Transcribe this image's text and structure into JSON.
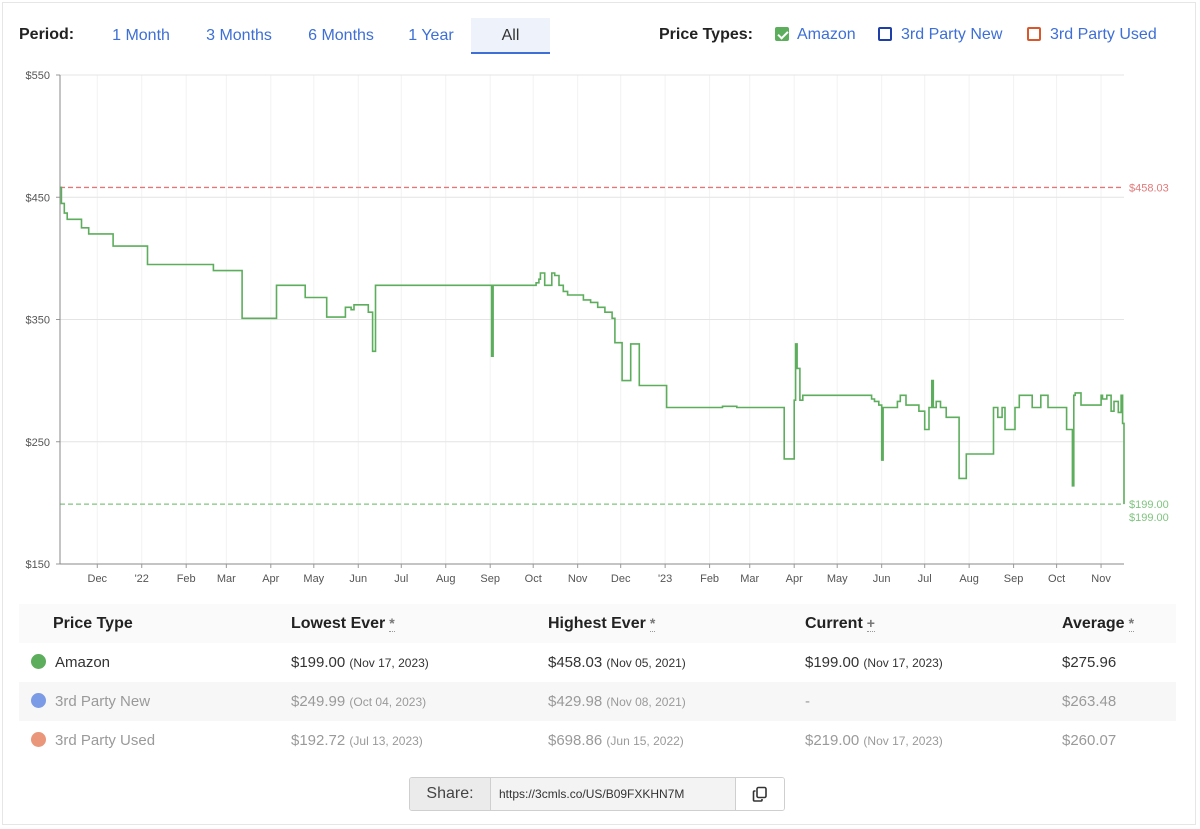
{
  "period": {
    "label": "Period:",
    "options": [
      "1 Month",
      "3 Months",
      "6 Months",
      "1 Year",
      "All"
    ],
    "selected": "All"
  },
  "price_types": {
    "label": "Price Types:",
    "items": [
      {
        "label": "Amazon",
        "checked": true,
        "color": "#5cad5c"
      },
      {
        "label": "3rd Party New",
        "checked": false,
        "color": "#1f3fa8"
      },
      {
        "label": "3rd Party Used",
        "checked": false,
        "color": "#d9582b"
      }
    ]
  },
  "chart_data": {
    "type": "line",
    "step": true,
    "y_ticks": [
      "$550",
      "$450",
      "$350",
      "$250",
      "$150"
    ],
    "ylim": [
      150,
      550
    ],
    "x_ticks": [
      "Dec",
      "'22",
      "Feb",
      "Mar",
      "Apr",
      "May",
      "Jun",
      "Jul",
      "Aug",
      "Sep",
      "Oct",
      "Nov",
      "Dec",
      "'23",
      "Feb",
      "Mar",
      "Apr",
      "May",
      "Jun",
      "Jul",
      "Aug",
      "Sep",
      "Oct",
      "Nov"
    ],
    "reference_lines": [
      {
        "label": "$458.03",
        "value": 458.03,
        "color": "#e07a7a"
      },
      {
        "label": "$199.00",
        "value": 199.0,
        "color": "#7fc47f"
      }
    ],
    "end_label": "$199.00",
    "grid": true,
    "series": [
      {
        "name": "Amazon",
        "color": "#5cad5c",
        "x": [
          "2021-11-05",
          "2021-11-06",
          "2021-11-08",
          "2021-11-10",
          "2021-11-12",
          "2021-11-20",
          "2021-11-25",
          "2021-12-05",
          "2021-12-12",
          "2022-01-05",
          "2022-02-20",
          "2022-03-12",
          "2022-04-05",
          "2022-04-25",
          "2022-04-28",
          "2022-05-10",
          "2022-05-20",
          "2022-05-23",
          "2022-05-27",
          "2022-05-29",
          "2022-06-01",
          "2022-06-08",
          "2022-06-11",
          "2022-06-13",
          "2022-06-17",
          "2022-08-15",
          "2022-09-02",
          "2022-09-03",
          "2022-09-09",
          "2022-09-30",
          "2022-10-03",
          "2022-10-05",
          "2022-10-06",
          "2022-10-09",
          "2022-10-14",
          "2022-10-16",
          "2022-10-19",
          "2022-10-22",
          "2022-10-25",
          "2022-11-05",
          "2022-11-10",
          "2022-11-15",
          "2022-11-20",
          "2022-11-25",
          "2022-11-27",
          "2022-12-02",
          "2022-12-08",
          "2022-12-14",
          "2023-01-02",
          "2023-01-20",
          "2023-02-01",
          "2023-02-10",
          "2023-02-20",
          "2023-03-01",
          "2023-03-10",
          "2023-03-23",
          "2023-03-25",
          "2023-04-01",
          "2023-04-02",
          "2023-04-03",
          "2023-04-05",
          "2023-04-07",
          "2023-04-15",
          "2023-05-05",
          "2023-05-15",
          "2023-05-25",
          "2023-05-27",
          "2023-05-30",
          "2023-06-01",
          "2023-06-02",
          "2023-06-10",
          "2023-06-12",
          "2023-06-14",
          "2023-06-18",
          "2023-06-20",
          "2023-06-27",
          "2023-07-01",
          "2023-07-03",
          "2023-07-04",
          "2023-07-06",
          "2023-07-07",
          "2023-07-09",
          "2023-07-12",
          "2023-07-13",
          "2023-07-16",
          "2023-07-25",
          "2023-07-30",
          "2023-08-18",
          "2023-08-21",
          "2023-08-24",
          "2023-08-26",
          "2023-09-01",
          "2023-09-02",
          "2023-09-05",
          "2023-09-14",
          "2023-09-20",
          "2023-09-25",
          "2023-10-08",
          "2023-10-10",
          "2023-10-11",
          "2023-10-12",
          "2023-10-13",
          "2023-10-14",
          "2023-10-18",
          "2023-11-01",
          "2023-11-02",
          "2023-11-05",
          "2023-11-08",
          "2023-11-10",
          "2023-11-13",
          "2023-11-15",
          "2023-11-16",
          "2023-11-17"
        ],
        "y": [
          458.03,
          445,
          437,
          432,
          432,
          425,
          420,
          420,
          410,
          395,
          390,
          351,
          378,
          368,
          368,
          352,
          352,
          360,
          358,
          362,
          362,
          356,
          324,
          378,
          378,
          378,
          320,
          378,
          378,
          378,
          380,
          383,
          388,
          378,
          388,
          386,
          378,
          373,
          370,
          366,
          364,
          360,
          356,
          351,
          331,
          300,
          330,
          296,
          278,
          278,
          278,
          279,
          278,
          278,
          278,
          278,
          236,
          284,
          330,
          310,
          284,
          288,
          288,
          288,
          288,
          285,
          283,
          280,
          235,
          278,
          278,
          283,
          288,
          280,
          280,
          275,
          260,
          260,
          278,
          300,
          278,
          283,
          278,
          278,
          270,
          220,
          240,
          278,
          270,
          278,
          260,
          260,
          278,
          288,
          278,
          288,
          278,
          260,
          260,
          260,
          214,
          288,
          290,
          280,
          288,
          285,
          288,
          275,
          283,
          274,
          288,
          265,
          199
        ]
      }
    ]
  },
  "table": {
    "headers": [
      "Price Type",
      "Lowest Ever",
      "Highest Ever",
      "Current",
      "Average"
    ],
    "header_marks": [
      "",
      "*",
      "*",
      "+",
      "*"
    ],
    "rows": [
      {
        "name": "Amazon",
        "color": "#5cad5c",
        "lowest": "$199.00",
        "lowest_date": "(Nov 17, 2023)",
        "highest": "$458.03",
        "highest_date": "(Nov 05, 2021)",
        "current": "$199.00",
        "current_date": "(Nov 17, 2023)",
        "average": "$275.96"
      },
      {
        "name": "3rd Party New",
        "color": "#7b9be6",
        "lowest": "$249.99",
        "lowest_date": "(Oct 04, 2023)",
        "highest": "$429.98",
        "highest_date": "(Nov 08, 2021)",
        "current": "-",
        "current_date": "",
        "average": "$263.48"
      },
      {
        "name": "3rd Party Used",
        "color": "#e9967a",
        "lowest": "$192.72",
        "lowest_date": "(Jul 13, 2023)",
        "highest": "$698.86",
        "highest_date": "(Jun 15, 2022)",
        "current": "$219.00",
        "current_date": "(Nov 17, 2023)",
        "average": "$260.07"
      }
    ]
  },
  "share": {
    "label": "Share:",
    "url": "https://3cmls.co/US/B09FXKHN7M",
    "copy_icon": "copy-icon"
  }
}
